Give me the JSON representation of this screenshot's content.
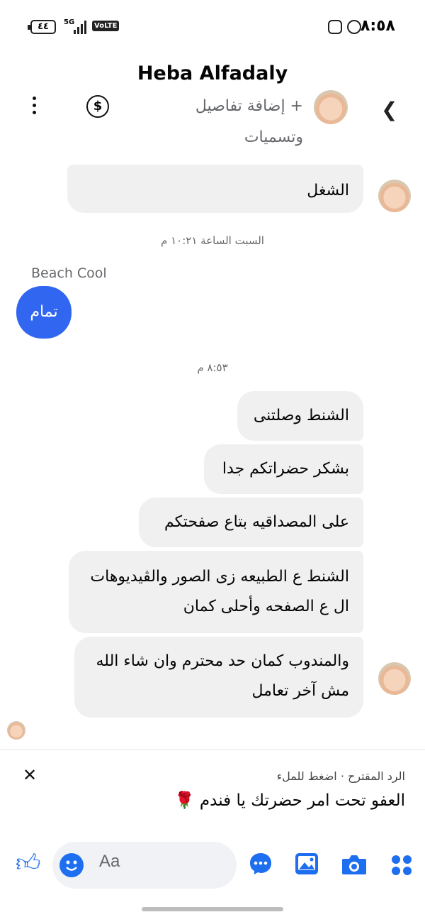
{
  "status_bar": {
    "time": "٨:٥٨",
    "battery": "٤٤",
    "network": "5G",
    "volte": "VoLTE"
  },
  "header": {
    "name": "Heba Alfadaly",
    "add_details": "+ إضافة تفاصيل",
    "labels": "وتسميات"
  },
  "messages": {
    "received_top": "الشغل",
    "timestamp1": "السبت الساعة ١٠:٢١ م",
    "sender_name": "Beach Cool",
    "sent1": "تمام",
    "timestamp2": "٨:٥٣ م",
    "r1": "الشنط وصلتنى",
    "r2": "بشكر حضراتكم جدا",
    "r3": "على المصداقيه بتاع صفحتكم",
    "r4_line1": "الشنط ع الطبيعه زى الصور والڤيديوهات",
    "r4_line2": "ال ع الصفحه وأحلى كمان",
    "r5_line1": "والمندوب كمان حد محترم وان شاء الله",
    "r5_line2": "مش آخر تعامل"
  },
  "suggestion": {
    "label": "الرد المقترح · اضغط للملء",
    "text": "العفو تحت امر حضرتك يا فندم 🌹"
  },
  "composer": {
    "placeholder": "Aa"
  },
  "colors": {
    "accent": "#3066f0",
    "bubble": "#f0f0f0",
    "icon_blue": "#1e6ef0"
  }
}
